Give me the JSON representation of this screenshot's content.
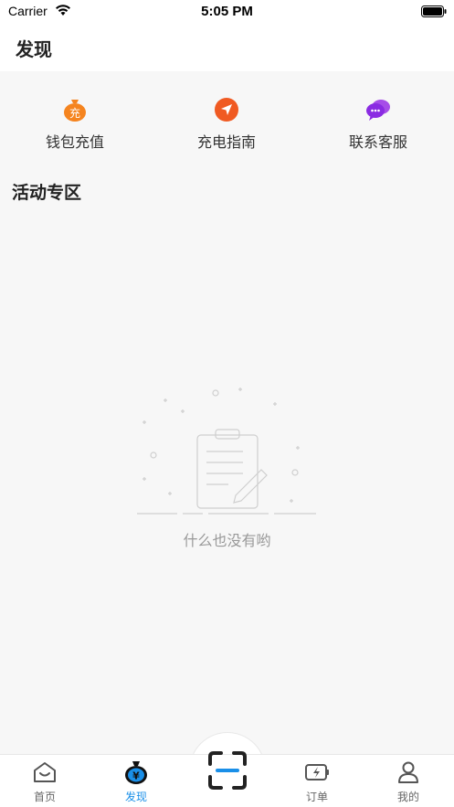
{
  "status_bar": {
    "carrier": "Carrier",
    "time": "5:05 PM"
  },
  "header": {
    "title": "发现"
  },
  "quick_actions": [
    {
      "label": "钱包充值",
      "icon": "wallet-recharge-icon",
      "color": "#f5841f",
      "glyph": "充"
    },
    {
      "label": "充电指南",
      "icon": "navigation-arrow-icon",
      "color": "#f05a22"
    },
    {
      "label": "联系客服",
      "icon": "chat-bubbles-icon",
      "color": "#8a2be2"
    }
  ],
  "section": {
    "title": "活动专区"
  },
  "empty_state": {
    "text": "什么也没有哟",
    "icon": "empty-clipboard-icon"
  },
  "tabs": [
    {
      "label": "首页",
      "icon": "home-icon",
      "active": false
    },
    {
      "label": "发现",
      "icon": "money-bag-icon",
      "active": true
    },
    {
      "label": "订单",
      "icon": "battery-charge-icon",
      "active": false
    },
    {
      "label": "我的",
      "icon": "user-icon",
      "active": false
    }
  ],
  "scan": {
    "icon": "scan-icon"
  },
  "colors": {
    "accent": "#1a8fe8",
    "background": "#f7f7f7",
    "muted": "#999999"
  }
}
